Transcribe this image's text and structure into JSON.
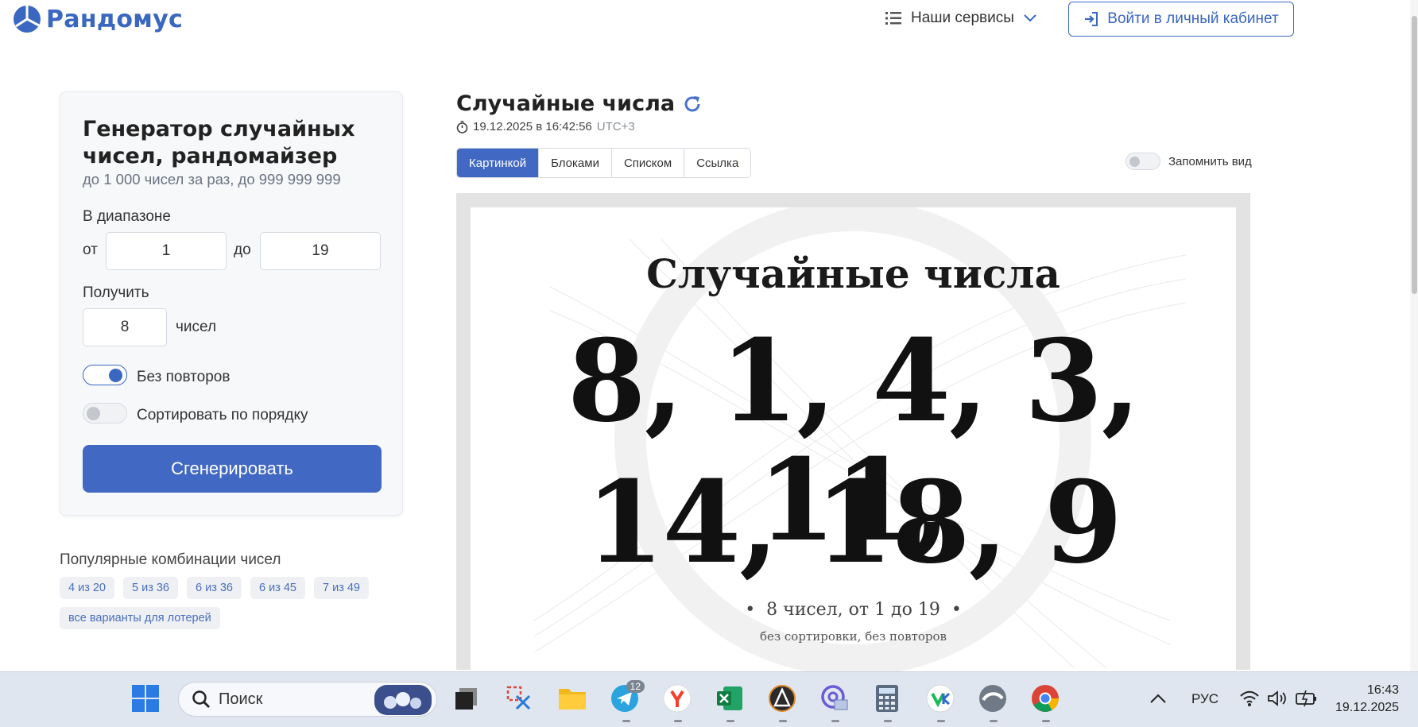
{
  "header": {
    "logo_text": "Рандомус",
    "services_label": "Наши сервисы",
    "login_label": "Войти в личный кабинет"
  },
  "generator": {
    "title": "Генератор случайных чисел, рандомайзер",
    "subtitle": "до 1 000 чисел за раз, до 999 999 999",
    "range_label": "В диапазоне",
    "from_label": "от",
    "from_value": "1",
    "to_label": "до",
    "to_value": "19",
    "get_label": "Получить",
    "count_value": "8",
    "count_unit": "чисел",
    "no_repeat_label": "Без повторов",
    "no_repeat_on": true,
    "sort_label": "Сортировать по порядку",
    "sort_on": false,
    "generate_label": "Сгенерировать"
  },
  "popular": {
    "title": "Популярные комбинации чисел",
    "chips": [
      "4 из 20",
      "5 из 36",
      "6 из 36",
      "6 из 45",
      "7 из 49",
      "все варианты для лотерей"
    ]
  },
  "result": {
    "title": "Случайные числа",
    "datetime": "19.12.2025 в 16:42:56",
    "timezone": "UTC+3",
    "tabs": [
      "Картинкой",
      "Блоками",
      "Списком",
      "Ссылка"
    ],
    "active_tab": "Картинкой",
    "remember_label": "Запомнить вид",
    "image": {
      "title": "Случайные числа",
      "line1": "8, 1, 4, 3, 11,",
      "line2": "14, 18, 9",
      "footer_main": "8 чисел, от 1 до 19",
      "footer_sub": "без сортировки, без повторов"
    }
  },
  "taskbar": {
    "search_placeholder": "Поиск",
    "telegram_badge": "12",
    "language": "РУС",
    "time": "16:43",
    "date": "19.12.2025"
  },
  "colors": {
    "brand": "#3a67c0",
    "button": "#4169c3"
  }
}
